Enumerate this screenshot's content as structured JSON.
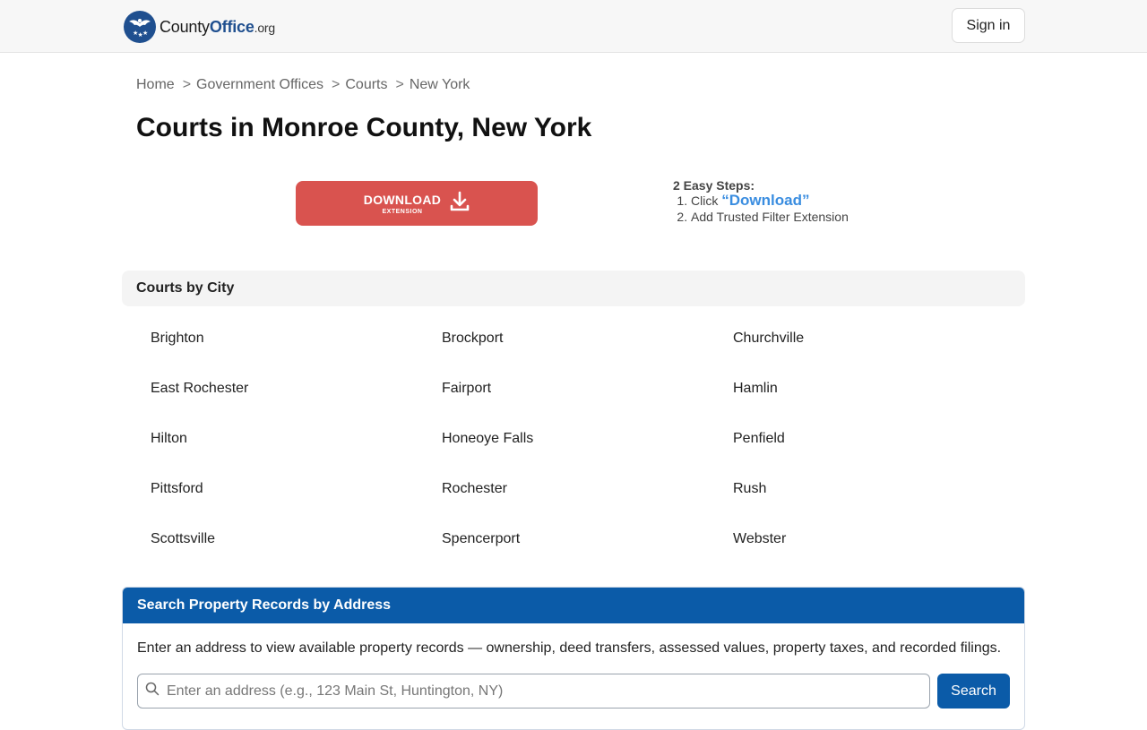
{
  "header": {
    "logo": {
      "part1": "County",
      "part2": "Office",
      "tld": ".org"
    },
    "signin_label": "Sign in"
  },
  "breadcrumb": {
    "sep": ">",
    "items": [
      "Home",
      "Government Offices",
      "Courts",
      "New York"
    ]
  },
  "page_title": "Courts in Monroe County, New York",
  "download": {
    "label": "DOWNLOAD",
    "sublabel": "EXTENSION",
    "icon": "download-icon"
  },
  "steps": {
    "title": "2 Easy Steps:",
    "step1_prefix": "Click ",
    "step1_link": "“Download”",
    "step2": "Add Trusted Filter Extension"
  },
  "cities": {
    "header": "Courts by City",
    "items": [
      "Brighton",
      "Brockport",
      "Churchville",
      "East Rochester",
      "Fairport",
      "Hamlin",
      "Hilton",
      "Honeoye Falls",
      "Penfield",
      "Pittsford",
      "Rochester",
      "Rush",
      "Scottsville",
      "Spencerport",
      "Webster"
    ]
  },
  "property_search": {
    "header": "Search Property Records by Address",
    "description": "Enter an address to view available property records — ownership, deed transfers, assessed values, property taxes, and recorded filings.",
    "placeholder": "Enter an address (e.g., 123 Main St, Huntington, NY)",
    "value": "",
    "button_label": "Search",
    "icon": "search-icon"
  },
  "colors": {
    "brand_blue": "#1f4f8f",
    "download_red": "#d9534f",
    "panel_blue": "#0b5ba8",
    "link_blue": "#3a8de0"
  }
}
